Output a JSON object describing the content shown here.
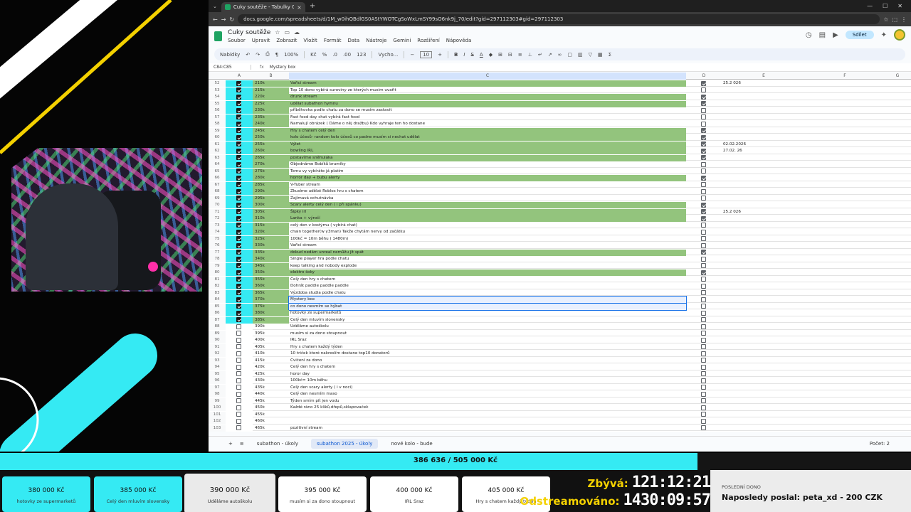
{
  "browser": {
    "tab_title": "Cuky soutěže - Tabulky Google",
    "url": "docs.google.com/spreadsheets/d/1M_w0ihQBdlGS0AStYWOTCgSoWxLmSY99sO6nk9j_70/edit?gid=297112303#gid=297112303"
  },
  "doc": {
    "title": "Cuky soutěže",
    "menus": [
      "Soubor",
      "Upravit",
      "Zobrazit",
      "Vložit",
      "Formát",
      "Data",
      "Nástroje",
      "Gemini",
      "Rozšíření",
      "Nápověda"
    ],
    "share_label": "Sdílet"
  },
  "toolbar": {
    "search": "Nabídky",
    "zoom": "100%",
    "currency": "Kč",
    "percent": "%",
    "dec1": ".0",
    "dec2": ".00",
    "numfmt": "123",
    "font": "Vycho...",
    "font_size": "10"
  },
  "formula": {
    "range": "C84:C85",
    "value": "Mystery box"
  },
  "columns": [
    "A",
    "B",
    "C",
    "D",
    "E",
    "F",
    "G"
  ],
  "rows": [
    {
      "n": "52",
      "a": true,
      "b": "210k",
      "c": "Vařicí stream",
      "hl": true,
      "d": true,
      "e": "25.2 026"
    },
    {
      "n": "53",
      "a": true,
      "b": "215k",
      "c": "Top 10 dono vybírá suroviny ze kterých musím uvařit",
      "hl": false,
      "d": false,
      "e": ""
    },
    {
      "n": "54",
      "a": true,
      "b": "220k",
      "c": "drunk stream",
      "hl": true,
      "d": true,
      "e": ""
    },
    {
      "n": "55",
      "a": true,
      "b": "225k",
      "c": "udělat subathon hymnu",
      "hl": true,
      "d": true,
      "e": ""
    },
    {
      "n": "56",
      "a": true,
      "b": "230k",
      "c": "příběhovka podle chatu za dono se musím zastavit",
      "hl": false,
      "d": false,
      "e": ""
    },
    {
      "n": "57",
      "a": true,
      "b": "235k",
      "c": "Fast food day chat vybírá fast food",
      "hl": false,
      "d": false,
      "e": ""
    },
    {
      "n": "58",
      "a": true,
      "b": "240k",
      "c": "Namalují obrázek ( Dáme o něj dražbu) Kdo vyhraje ten ho dostane",
      "hl": false,
      "d": false,
      "e": ""
    },
    {
      "n": "59",
      "a": true,
      "b": "245k",
      "c": "Hry s chatem celý den",
      "hl": true,
      "d": true,
      "e": ""
    },
    {
      "n": "60",
      "a": true,
      "b": "250k",
      "c": "kolo účesů- random kolo účesů co padne musím si nechat udělat",
      "hl": true,
      "d": true,
      "e": ""
    },
    {
      "n": "61",
      "a": true,
      "b": "255k",
      "c": "Výlet",
      "hl": true,
      "d": true,
      "e": "02.02.2026"
    },
    {
      "n": "62",
      "a": true,
      "b": "260k",
      "c": "bowling IRL",
      "hl": true,
      "d": true,
      "e": "27.02. 26"
    },
    {
      "n": "63",
      "a": true,
      "b": "265k",
      "c": "postavíme sněhuláka",
      "hl": true,
      "d": true,
      "e": ""
    },
    {
      "n": "64",
      "a": true,
      "b": "270k",
      "c": "Objednáme Bobíků brumíky",
      "hl": false,
      "d": false,
      "e": ""
    },
    {
      "n": "65",
      "a": true,
      "b": "275k",
      "c": "Temu vy vybíráte já platím",
      "hl": false,
      "d": false,
      "e": ""
    },
    {
      "n": "66",
      "a": true,
      "b": "280k",
      "c": "horror day + bubu alerty",
      "hl": true,
      "d": true,
      "e": ""
    },
    {
      "n": "67",
      "a": true,
      "b": "285k",
      "c": "V-Tuber stream",
      "hl": false,
      "d": false,
      "e": ""
    },
    {
      "n": "68",
      "a": true,
      "b": "290k",
      "c": "Zkusíme udělat Roblox hru s chatem",
      "hl": false,
      "d": false,
      "e": ""
    },
    {
      "n": "69",
      "a": true,
      "b": "295k",
      "c": "Zajímavá ochutnávka",
      "hl": false,
      "d": false,
      "e": ""
    },
    {
      "n": "70",
      "a": true,
      "b": "300k",
      "c": "Scary alerty celý den ( i při spánku)",
      "hl": true,
      "d": true,
      "e": ""
    },
    {
      "n": "71",
      "a": true,
      "b": "305k",
      "c": "Šipky irl",
      "hl": true,
      "d": true,
      "e": "25.2 026"
    },
    {
      "n": "72",
      "a": true,
      "b": "310k",
      "c": "Lanka + výročí",
      "hl": true,
      "d": true,
      "e": ""
    },
    {
      "n": "73",
      "a": true,
      "b": "315k",
      "c": "celý den v kostýmu ( vybírá chat)",
      "hl": false,
      "d": false,
      "e": ""
    },
    {
      "n": "74",
      "a": true,
      "b": "320k",
      "c": "chain together(w y3man) Takže chytám nervy od začátku",
      "hl": false,
      "d": false,
      "e": ""
    },
    {
      "n": "75",
      "a": true,
      "b": "325k",
      "c": "100kč = 10m běhu ( 1480m)",
      "hl": false,
      "d": false,
      "e": ""
    },
    {
      "n": "76",
      "a": true,
      "b": "330k",
      "c": "Vařicí stream",
      "hl": false,
      "d": false,
      "e": ""
    },
    {
      "n": "77",
      "a": true,
      "b": "335k",
      "c": "dokud nedám unreal nemůžu jít spát",
      "hl": true,
      "d": true,
      "e": ""
    },
    {
      "n": "78",
      "a": true,
      "b": "340k",
      "c": "Single player hra podle chatu",
      "hl": false,
      "d": false,
      "e": ""
    },
    {
      "n": "79",
      "a": true,
      "b": "345k",
      "c": "keep talking and nobody explode",
      "hl": false,
      "d": false,
      "e": ""
    },
    {
      "n": "80",
      "a": true,
      "b": "350k",
      "c": "elektro šoky",
      "hl": true,
      "d": true,
      "e": ""
    },
    {
      "n": "81",
      "a": true,
      "b": "355k",
      "c": "Celý den hry s chatem",
      "hl": false,
      "d": false,
      "e": ""
    },
    {
      "n": "82",
      "a": true,
      "b": "360k",
      "c": "Dohrát paddle paddle paddle",
      "hl": false,
      "d": false,
      "e": ""
    },
    {
      "n": "83",
      "a": true,
      "b": "365k",
      "c": "Výzdoba studia podle chatu",
      "hl": false,
      "d": false,
      "e": ""
    },
    {
      "n": "84",
      "a": true,
      "b": "370k",
      "c": "Mystery box",
      "hl": false,
      "d": false,
      "e": ""
    },
    {
      "n": "85",
      "a": true,
      "b": "375k",
      "c": "co dono nesmím se hýbat",
      "hl": false,
      "d": false,
      "e": ""
    },
    {
      "n": "86",
      "a": true,
      "b": "380k",
      "c": "hotovky ze supermarketů",
      "hl": false,
      "d": false,
      "e": ""
    },
    {
      "n": "87",
      "a": true,
      "b": "385k",
      "c": "Celý den mluvím slovensky",
      "hl": false,
      "d": false,
      "e": ""
    },
    {
      "n": "88",
      "a": false,
      "b": "390k",
      "c": "Udělámе autoškolu",
      "hl": false,
      "d": false,
      "e": ""
    },
    {
      "n": "89",
      "a": false,
      "b": "395k",
      "c": "musím si za dono stoupnout",
      "hl": false,
      "d": false,
      "e": ""
    },
    {
      "n": "90",
      "a": false,
      "b": "400k",
      "c": "IRL Sraz",
      "hl": false,
      "d": false,
      "e": ""
    },
    {
      "n": "91",
      "a": false,
      "b": "405k",
      "c": "Hry s chatem každý týden",
      "hl": false,
      "d": false,
      "e": ""
    },
    {
      "n": "92",
      "a": false,
      "b": "410k",
      "c": "10 triček které nakreslím dostane top10 donatorů",
      "hl": false,
      "d": false,
      "e": ""
    },
    {
      "n": "93",
      "a": false,
      "b": "415k",
      "c": "Cvičení za dono",
      "hl": false,
      "d": false,
      "e": ""
    },
    {
      "n": "94",
      "a": false,
      "b": "420k",
      "c": "Celý den hry s chatem",
      "hl": false,
      "d": false,
      "e": ""
    },
    {
      "n": "95",
      "a": false,
      "b": "425k",
      "c": "horor day",
      "hl": false,
      "d": false,
      "e": ""
    },
    {
      "n": "96",
      "a": false,
      "b": "430k",
      "c": "100kč= 10m běhu",
      "hl": false,
      "d": false,
      "e": ""
    },
    {
      "n": "97",
      "a": false,
      "b": "435k",
      "c": "Celý den scary alerty ( i v noci)",
      "hl": false,
      "d": false,
      "e": ""
    },
    {
      "n": "98",
      "a": false,
      "b": "440k",
      "c": "Celý den nesmím maso",
      "hl": false,
      "d": false,
      "e": ""
    },
    {
      "n": "99",
      "a": false,
      "b": "445k",
      "c": "Týden smím pít jen vodu",
      "hl": false,
      "d": false,
      "e": ""
    },
    {
      "n": "100",
      "a": false,
      "b": "450k",
      "c": "Každé ráno 25 kliků,dřepů,sklapovaček",
      "hl": false,
      "d": false,
      "e": ""
    },
    {
      "n": "101",
      "a": false,
      "b": "455k",
      "c": "",
      "hl": false,
      "d": false,
      "e": ""
    },
    {
      "n": "102",
      "a": false,
      "b": "460k",
      "c": "",
      "hl": false,
      "d": false,
      "e": ""
    },
    {
      "n": "103",
      "a": false,
      "b": "465k",
      "c": "pozitivní stream",
      "hl": false,
      "d": false,
      "e": ""
    }
  ],
  "sheet_tabs": [
    "subathon - úkoly",
    "subathon 2025 - úkoly",
    "nové kolo - bude"
  ],
  "count_label": "Počet: 2",
  "overlay": {
    "progress_text": "386 636 / 505 000 Kč",
    "progress_fraction": 0.7656,
    "cards": [
      {
        "price": "380 000 Kč",
        "desc": "hotovky ze supermarketů",
        "style": "cyan"
      },
      {
        "price": "385 000 Kč",
        "desc": "Celý den mluvím slovensky",
        "style": "cyan"
      },
      {
        "price": "390 000 Kč",
        "desc": "Udělámе autoškolu",
        "style": "current"
      },
      {
        "price": "395 000 Kč",
        "desc": "musím si za dono stoupnout",
        "style": "white"
      },
      {
        "price": "400 000 Kč",
        "desc": "IRL Sraz",
        "style": "white"
      },
      {
        "price": "405 000 Kč",
        "desc": "Hry s chatem každý týden",
        "style": "white"
      }
    ],
    "zbyva_label": "Zbývá:",
    "zbyva_value": "121:12:21",
    "odstreamovano_label": "Odstreamováno:",
    "odstreamovano_value": "1430:09:57",
    "last_dono_label": "POSLEDNÍ DONO",
    "last_dono_text": "Naposledy poslal: peta_xd - 200 CZK"
  },
  "colors": {
    "accent_cyan": "#35eaf3",
    "row_highlight": "#93c47d",
    "sheets_green": "#1ea362",
    "timer_yellow": "#f4d100"
  }
}
